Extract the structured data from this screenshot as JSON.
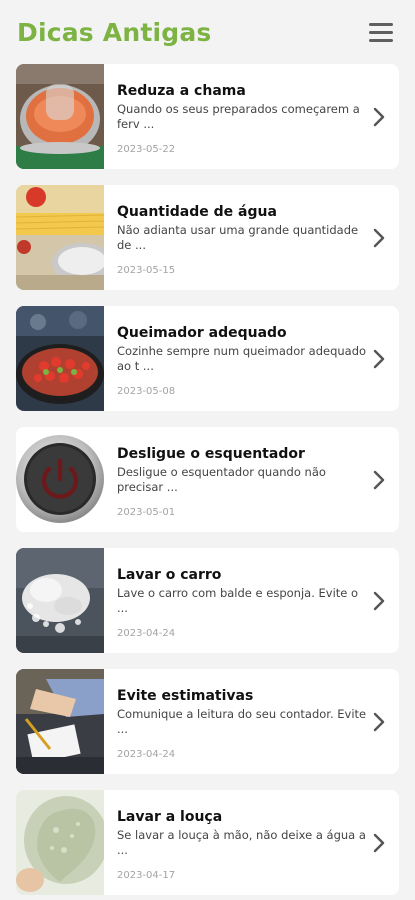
{
  "app": {
    "title": "Dicas Antigas"
  },
  "icons": {
    "menu": "hamburger-menu-icon",
    "chevron": "chevron-right-icon"
  },
  "colors": {
    "accent": "#7cb342"
  },
  "tips": [
    {
      "title": "Reduza a chama",
      "desc": "Quando os seus preparados começarem a ferv ...",
      "date": "2023-05-22"
    },
    {
      "title": "Quantidade de água",
      "desc": "Não adianta usar uma grande quantidade de  ...",
      "date": "2023-05-15"
    },
    {
      "title": "Queimador adequado",
      "desc": "Cozinhe sempre num queimador adequado ao t ...",
      "date": "2023-05-08"
    },
    {
      "title": "Desligue o esquentador",
      "desc": "Desligue o esquentador quando não precisar ...",
      "date": "2023-05-01"
    },
    {
      "title": "Lavar o carro",
      "desc": "Lave o carro com balde e esponja. Evite o ...",
      "date": "2023-04-24"
    },
    {
      "title": "Evite estimativas",
      "desc": "Comunique a leitura do seu contador. Evite ...",
      "date": "2023-04-24"
    },
    {
      "title": "Lavar a louça",
      "desc": "Se lavar a louça à mão, não deixe a água a ...",
      "date": "2023-04-17"
    }
  ]
}
